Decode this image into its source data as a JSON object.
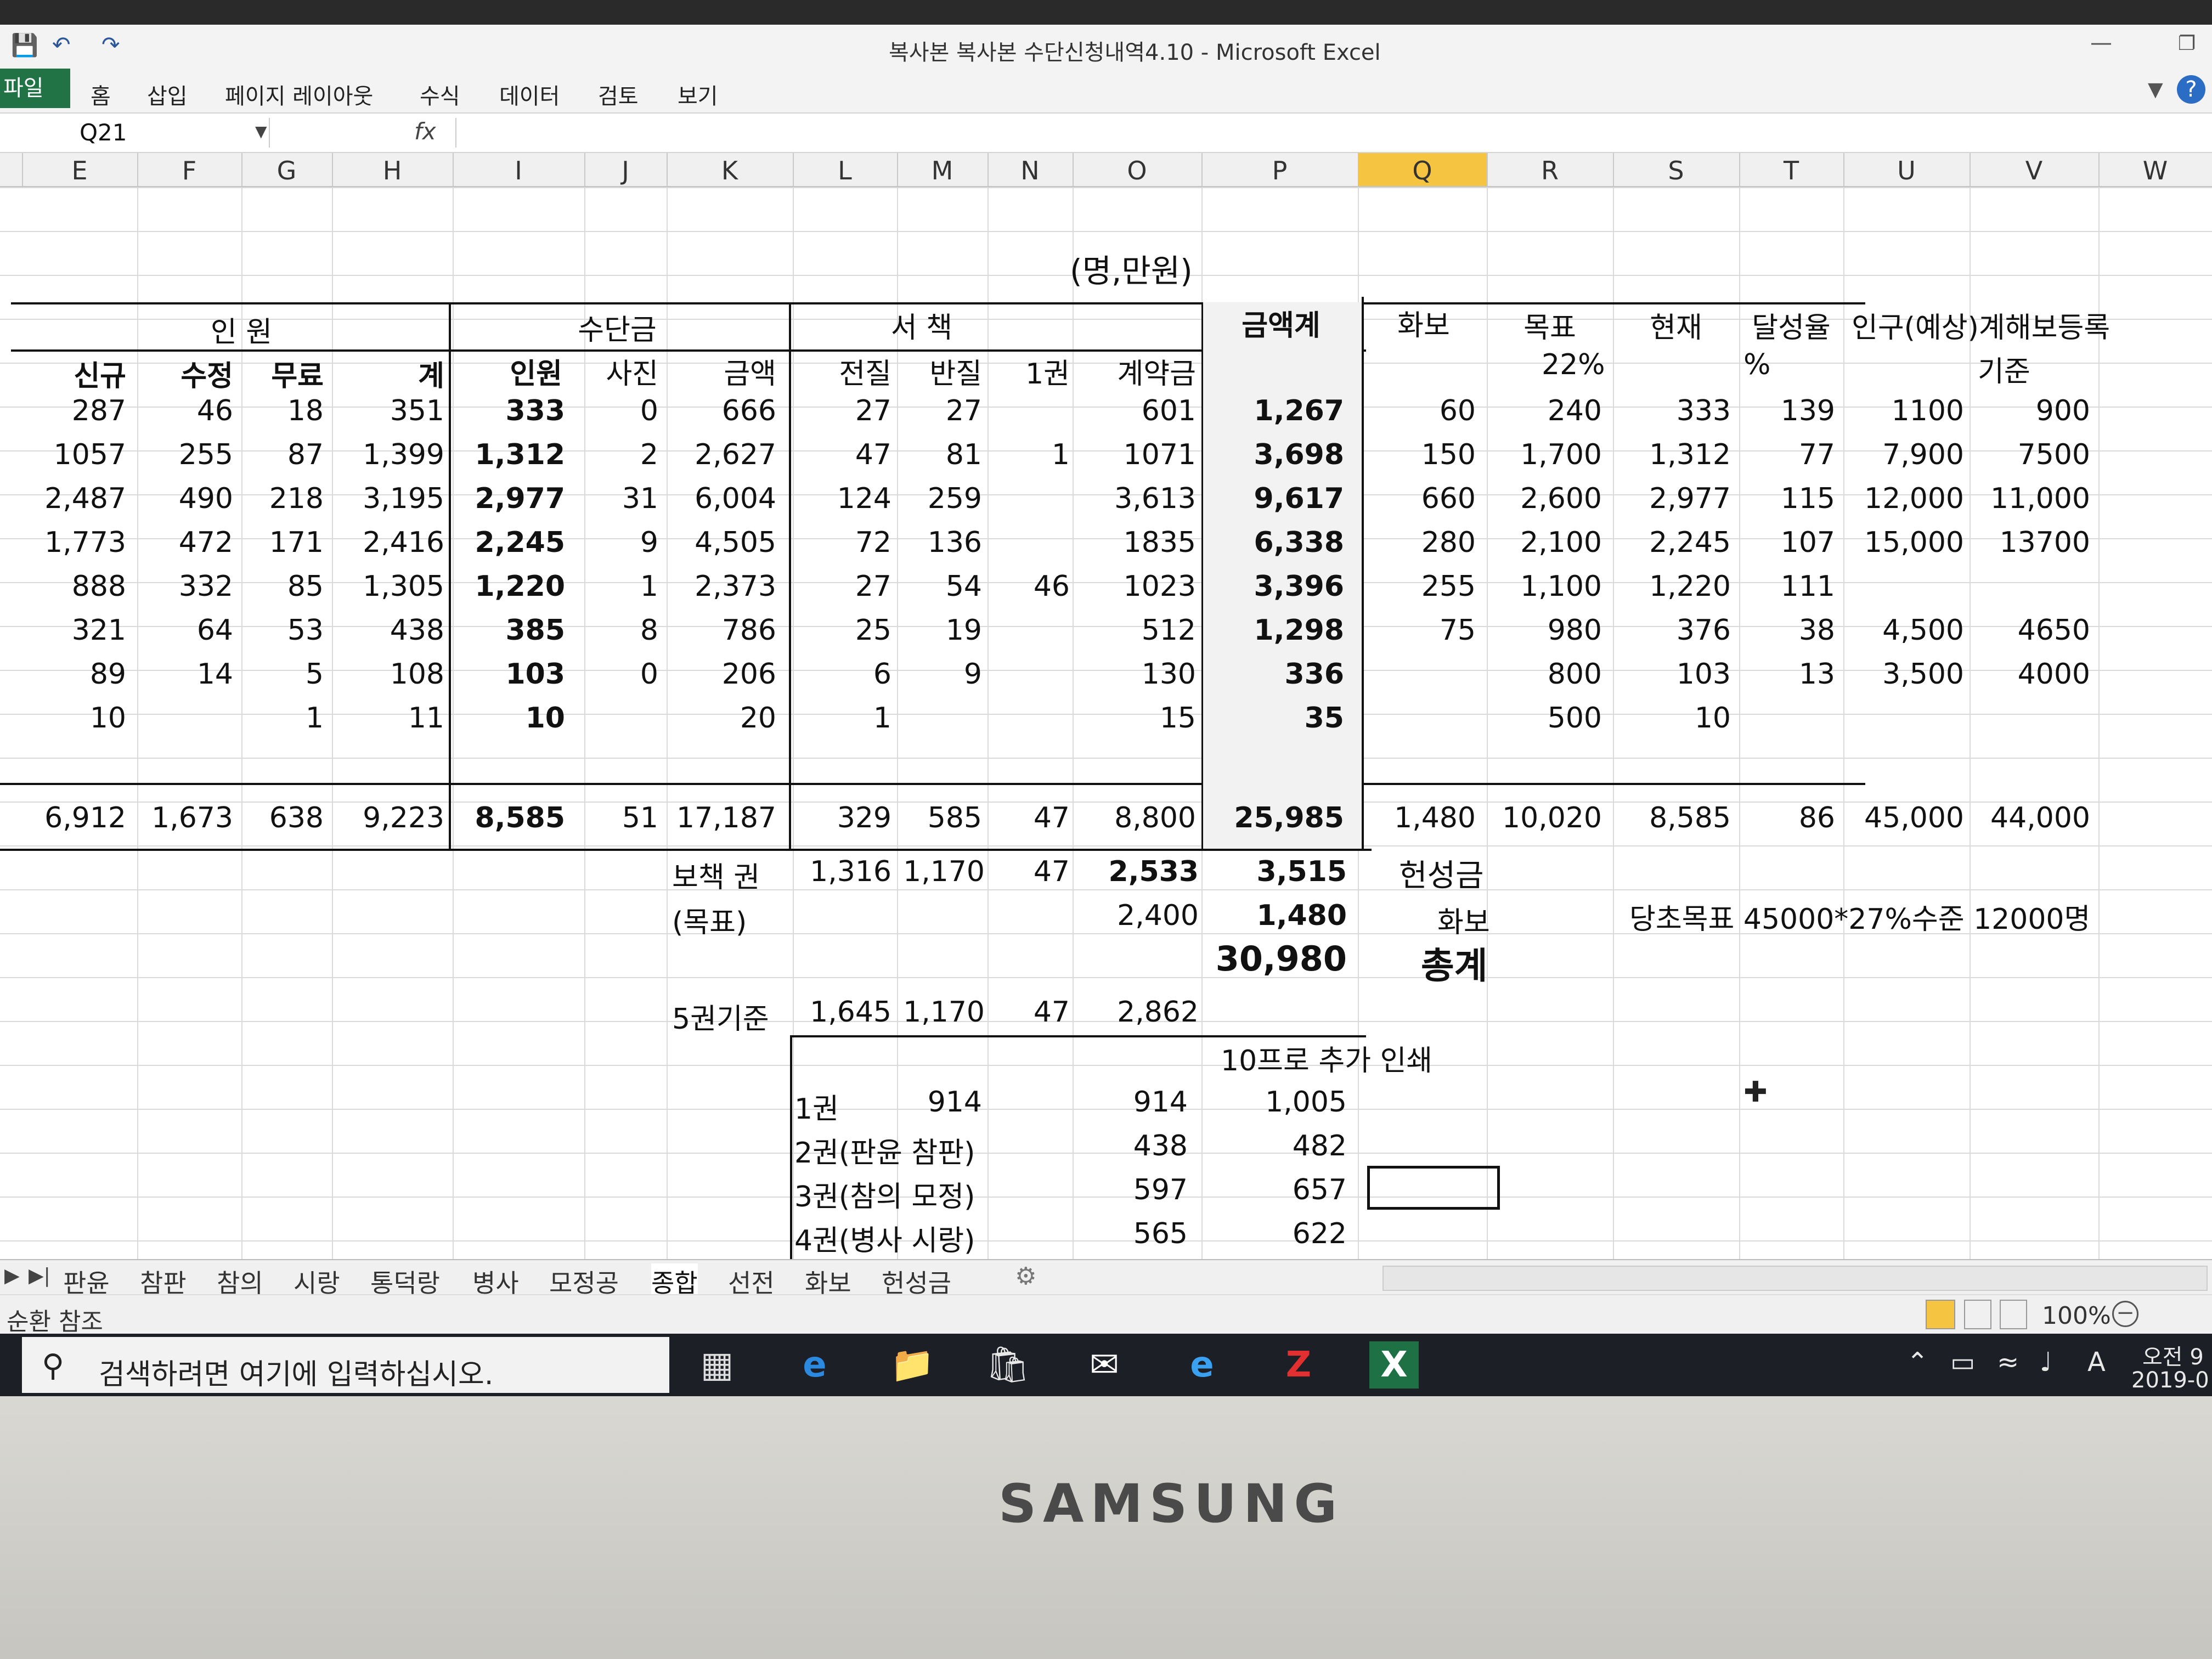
{
  "window": {
    "title": "복사본 복사본 수단신청내역4.10 - Microsoft Excel"
  },
  "ribbon": {
    "tabs": [
      "파일",
      "홈",
      "삽입",
      "페이지 레이아웃",
      "수식",
      "데이터",
      "검토",
      "보기"
    ]
  },
  "formula_bar": {
    "name_box": "Q21",
    "fx": "fx"
  },
  "columns": [
    "E",
    "F",
    "G",
    "H",
    "I",
    "J",
    "K",
    "L",
    "M",
    "N",
    "O",
    "P",
    "Q",
    "R",
    "S",
    "T",
    "U",
    "V",
    "W"
  ],
  "selected_column": "Q",
  "sheet": {
    "unit_note": "(명,만원)",
    "group_headers": {
      "inwon": "인 원",
      "sudangeum": "수단금",
      "seochaek": "서 책",
      "geumaekgye": "금액계",
      "hwabo": "화보",
      "mokpyo": "목표",
      "hyeonjae": "현재",
      "dalseongyul": "달성율",
      "ingu": "인구(예상)계해보등록",
      "ingu_sub": "기준",
      "mokpyo_pct": "22%",
      "pct_sign": "%"
    },
    "sub_headers": [
      "신규",
      "수정",
      "무료",
      "계",
      "인원",
      "사진",
      "금액",
      "전질",
      "반질",
      "1권",
      "계약금"
    ],
    "rows": [
      [
        "287",
        "46",
        "18",
        "351",
        "333",
        "0",
        "666",
        "27",
        "27",
        "",
        "601",
        "1,267",
        "60",
        "240",
        "333",
        "139",
        "1100",
        "900"
      ],
      [
        "1057",
        "255",
        "87",
        "1,399",
        "1,312",
        "2",
        "2,627",
        "47",
        "81",
        "1",
        "1071",
        "3,698",
        "150",
        "1,700",
        "1,312",
        "77",
        "7,900",
        "7500"
      ],
      [
        "2,487",
        "490",
        "218",
        "3,195",
        "2,977",
        "31",
        "6,004",
        "124",
        "259",
        "",
        "3,613",
        "9,617",
        "660",
        "2,600",
        "2,977",
        "115",
        "12,000",
        "11,000"
      ],
      [
        "1,773",
        "472",
        "171",
        "2,416",
        "2,245",
        "9",
        "4,505",
        "72",
        "136",
        "",
        "1835",
        "6,338",
        "280",
        "2,100",
        "2,245",
        "107",
        "15,000",
        "13700"
      ],
      [
        "888",
        "332",
        "85",
        "1,305",
        "1,220",
        "1",
        "2,373",
        "27",
        "54",
        "46",
        "1023",
        "3,396",
        "255",
        "1,100",
        "1,220",
        "111",
        "",
        ""
      ],
      [
        "321",
        "64",
        "53",
        "438",
        "385",
        "8",
        "786",
        "25",
        "19",
        "",
        "512",
        "1,298",
        "75",
        "980",
        "376",
        "38",
        "4,500",
        "4650"
      ],
      [
        "89",
        "14",
        "5",
        "108",
        "103",
        "0",
        "206",
        "6",
        "9",
        "",
        "130",
        "336",
        "",
        "800",
        "103",
        "13",
        "3,500",
        "4000"
      ],
      [
        "10",
        "",
        "1",
        "11",
        "10",
        "",
        "20",
        "1",
        "",
        "",
        "15",
        "35",
        "",
        "500",
        "10",
        "",
        "",
        ""
      ]
    ],
    "totals": [
      "6,912",
      "1,673",
      "638",
      "9,223",
      "8,585",
      "51",
      "17,187",
      "329",
      "585",
      "47",
      "8,800",
      "25,985",
      "1,480",
      "10,020",
      "8,585",
      "86",
      "45,000",
      "44,000"
    ],
    "bochaek": {
      "label": "보책 권",
      "values": [
        "1,316",
        "1,170",
        "47",
        "2,533",
        "3,515"
      ],
      "note": "헌성금"
    },
    "mokpyo_row": {
      "label": "(목표)",
      "o": "2,400",
      "p": "1,480",
      "q": "화보",
      "note": "당초목표 45000*27%수준 12000명"
    },
    "total_row": {
      "p": "30,980",
      "q": "총계"
    },
    "gwon5": {
      "label": "5권기준",
      "values": [
        "1,645",
        "1,170",
        "47",
        "2,862"
      ]
    },
    "reprint_label": "10프로 추가 인쇄",
    "volumes": [
      {
        "name": "1권",
        "m": "914",
        "o": "914",
        "p": "1,005"
      },
      {
        "name": "2권(판윤 참판)",
        "m": "",
        "o": "438",
        "p": "482"
      },
      {
        "name": "3권(참의 모정)",
        "m": "",
        "o": "597",
        "p": "657"
      },
      {
        "name": "4권(병사 시랑)",
        "m": "",
        "o": "565",
        "p": "622"
      }
    ]
  },
  "sheet_tabs": [
    "판윤",
    "참판",
    "참의",
    "시랑",
    "통덕랑",
    "병사",
    "모정공",
    "종합",
    "선전",
    "화보",
    "헌성금"
  ],
  "active_tab": "종합",
  "status": {
    "left": "순환 참조",
    "zoom": "100%"
  },
  "taskbar": {
    "search_placeholder": "검색하려면 여기에 입력하십시오.",
    "time": "오전 9",
    "date": "2019-0"
  },
  "bezel": {
    "brand": "SAMSUNG"
  }
}
